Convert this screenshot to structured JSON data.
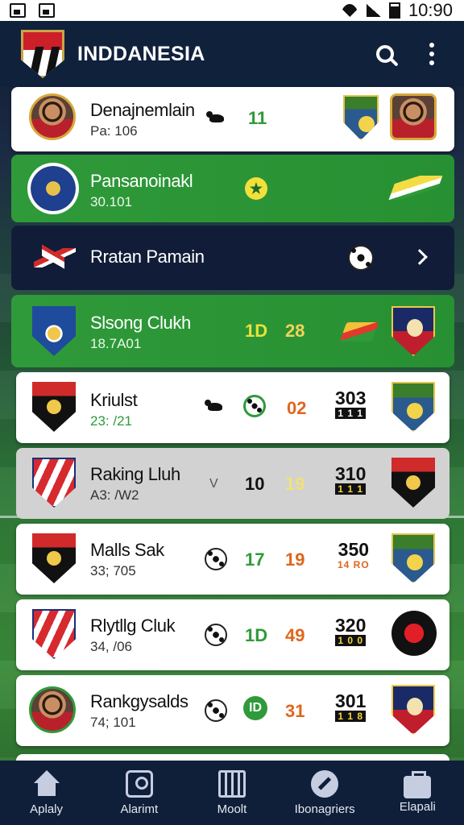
{
  "status_bar": {
    "time": "10:90"
  },
  "app": {
    "title": "INDDANESIA"
  },
  "rows": [
    {
      "name": "Denajnemlain",
      "sub": "Pa: 106",
      "num1": "11"
    },
    {
      "name": "Pansanoinakl",
      "sub": "30.101"
    },
    {
      "name": "Rratan Pamain"
    },
    {
      "name": "Slsong Clukh",
      "sub": "18.7A01",
      "num1": "1D",
      "num2": "28"
    },
    {
      "name": "Kriulst",
      "sub": "23: /21",
      "num2": "02",
      "score": "303",
      "score_sub": "1 1 1"
    },
    {
      "name": "Raking Lluh",
      "sub": "A3: /W2",
      "marker": "V",
      "num1": "10",
      "num2": "19",
      "score": "310",
      "score_sub": "1 1 1"
    },
    {
      "name": "Malls Sak",
      "sub": "33; 705",
      "num1": "17",
      "num2": "19",
      "score": "350",
      "score_sub": "14 RO"
    },
    {
      "name": "Rlytllg Cluk",
      "sub": "34, /06",
      "num1": "1D",
      "num2": "49",
      "score": "320",
      "score_sub": "1 0 0"
    },
    {
      "name": "Rankgysalds",
      "sub": "74; 101",
      "num1": "ID",
      "num2": "31",
      "score": "301",
      "score_sub": "1 1 8"
    }
  ],
  "nav": [
    {
      "label": "Aplaly",
      "icon": "home-icon"
    },
    {
      "label": "Alarimt",
      "icon": "pin-icon"
    },
    {
      "label": "Moolt",
      "icon": "grid-icon"
    },
    {
      "label": "Ibonagriers",
      "icon": "whistle-icon"
    },
    {
      "label": "Elapali",
      "icon": "bag-icon"
    }
  ],
  "colors": {
    "header": "#10213c",
    "green_row": "#2f9a3a",
    "navy_row": "#111d38",
    "accent_orange": "#e0661c"
  }
}
